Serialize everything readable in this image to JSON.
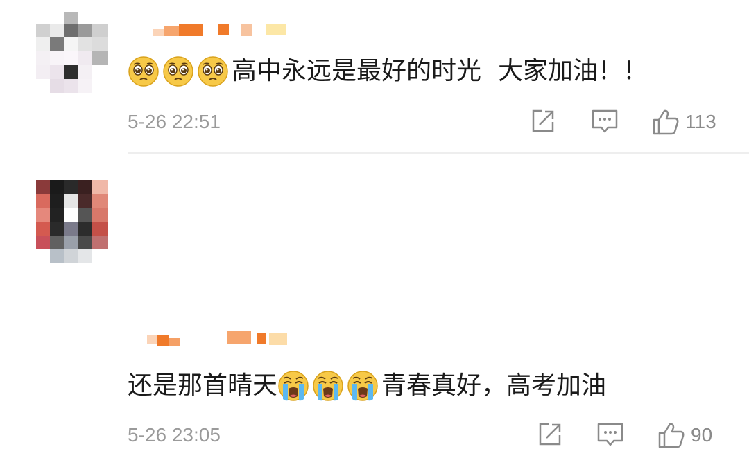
{
  "comments": [
    {
      "text_part1": "高中永远是最好的时光",
      "text_part2": "大家加油！！",
      "emoji_prefix": [
        "pleading-face",
        "pleading-face",
        "pleading-face"
      ],
      "timestamp": "5-26 22:51",
      "like_count": "113"
    },
    {
      "text_part1": "还是那首晴天",
      "text_part2": "青春真好，高考加油",
      "emoji_middle": [
        "loudly-crying-face",
        "loudly-crying-face",
        "loudly-crying-face"
      ],
      "timestamp": "5-26 23:05",
      "like_count": "90"
    }
  ],
  "colors": {
    "text": "#1a1a1a",
    "meta": "#9a9a9a",
    "username_orange": "#f07a2a",
    "divider": "#eeeeee"
  },
  "icons": {
    "share": "share-icon",
    "reply": "comment-reply-icon",
    "like": "thumbs-up-icon"
  }
}
